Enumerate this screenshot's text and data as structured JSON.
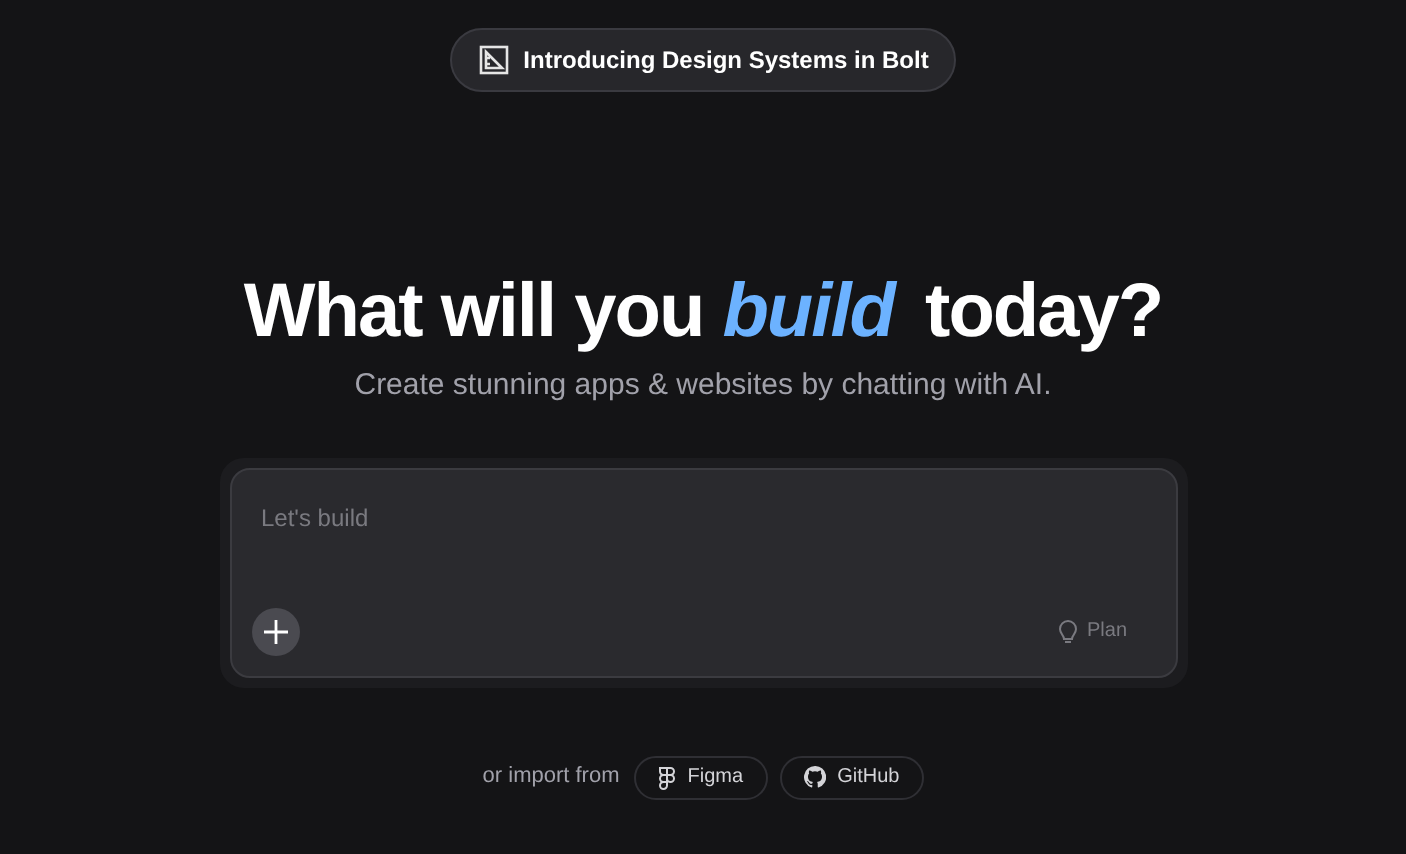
{
  "announcement": {
    "label": "Introducing Design Systems in Bolt"
  },
  "hero": {
    "title": "What will you *build* today?",
    "subtitle": "Create stunning apps & websites by chatting with AI."
  },
  "prompt": {
    "placeholder": "Let's build",
    "plan_label": "Plan"
  },
  "import": {
    "label": "or import from",
    "sources": [
      {
        "label": "Figma",
        "kind": "figma"
      },
      {
        "label": "GitHub",
        "kind": "github"
      }
    ]
  }
}
